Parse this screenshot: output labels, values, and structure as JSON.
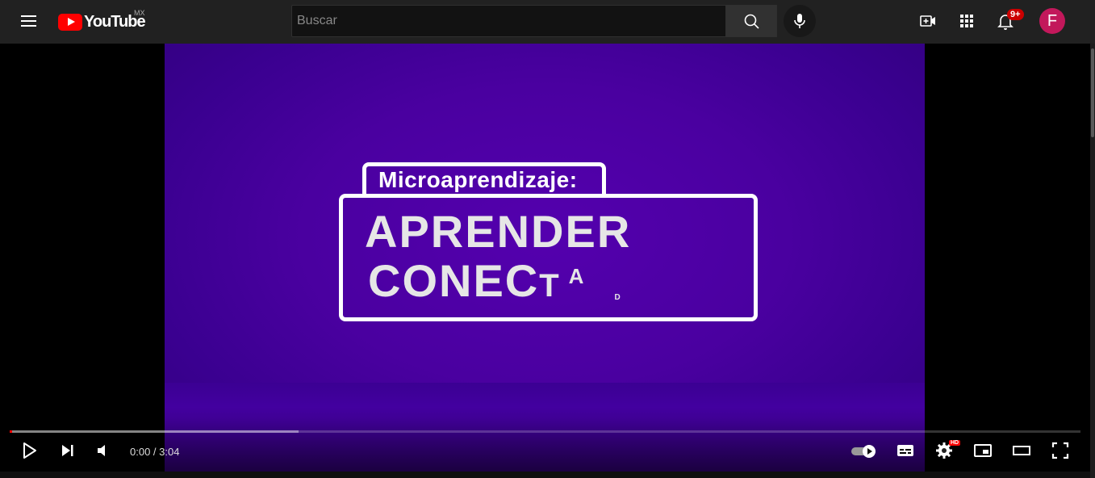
{
  "header": {
    "logo_text": "YouTube",
    "country_code": "MX",
    "search_placeholder": "Buscar",
    "notification_count": "9+",
    "avatar_letter": "F"
  },
  "video": {
    "tab_text": "Microaprendizaje:",
    "line1": "APRENDER",
    "line2_main": "CONEC",
    "line2_t": "T",
    "line2_a": "A",
    "line2_d": "D"
  },
  "controls": {
    "current_time": "0:00",
    "separator": " / ",
    "duration": "3:04",
    "played_fraction": 0.0,
    "buffered_fraction": 0.27,
    "hd_badge": "HD"
  },
  "colors": {
    "brand_red": "#ff0000",
    "avatar_bg": "#c2185b",
    "video_bg": "#4a00a0"
  }
}
